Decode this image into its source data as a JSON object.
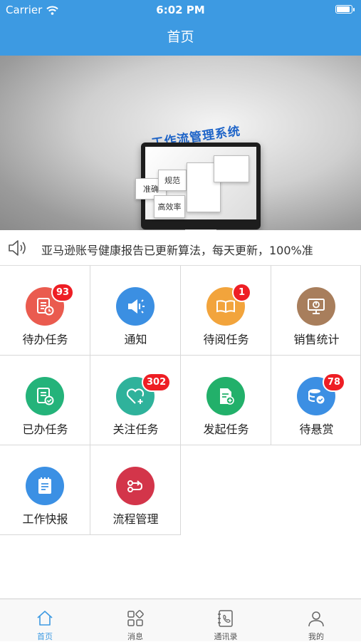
{
  "status_bar": {
    "carrier": "Carrier",
    "time": "6:02 PM"
  },
  "nav": {
    "title": "首页"
  },
  "banner": {
    "headline": "工作流管理系统",
    "cards": [
      "准确",
      "规范",
      "高效率"
    ],
    "active_slide": 2,
    "slide_count": 3
  },
  "notice": {
    "text": "亚马逊账号健康报告已更新算法，每天更新，100%准"
  },
  "grid": [
    {
      "label": "待办任务",
      "icon": "task-list-clock-icon",
      "color": "#ea5b4f",
      "badge": "93"
    },
    {
      "label": "通知",
      "icon": "megaphone-icon",
      "color": "#3b8fe2",
      "badge": ""
    },
    {
      "label": "待阅任务",
      "icon": "open-book-icon",
      "color": "#f2a43c",
      "badge": "1"
    },
    {
      "label": "销售统计",
      "icon": "monitor-chart-icon",
      "color": "#a87e5c",
      "badge": ""
    },
    {
      "label": "已办任务",
      "icon": "task-check-icon",
      "color": "#24b37a",
      "badge": ""
    },
    {
      "label": "关注任务",
      "icon": "heart-plus-icon",
      "color": "#2fb29b",
      "badge": "302"
    },
    {
      "label": "发起任务",
      "icon": "document-plus-icon",
      "color": "#22b06a",
      "badge": ""
    },
    {
      "label": "待悬赏",
      "icon": "coins-check-icon",
      "color": "#3c8fe3",
      "badge": "78"
    },
    {
      "label": "工作快报",
      "icon": "notepad-icon",
      "color": "#3b90e4",
      "badge": ""
    },
    {
      "label": "流程管理",
      "icon": "flow-icon",
      "color": "#d3354a",
      "badge": ""
    }
  ],
  "tabbar": [
    {
      "label": "首页",
      "icon": "home-icon",
      "active": true
    },
    {
      "label": "消息",
      "icon": "grid-icon",
      "active": false
    },
    {
      "label": "通讯录",
      "icon": "contacts-icon",
      "active": false
    },
    {
      "label": "我的",
      "icon": "person-icon",
      "active": false
    }
  ],
  "colors": {
    "primary": "#3d9ae2",
    "badge": "#ee1e24"
  }
}
